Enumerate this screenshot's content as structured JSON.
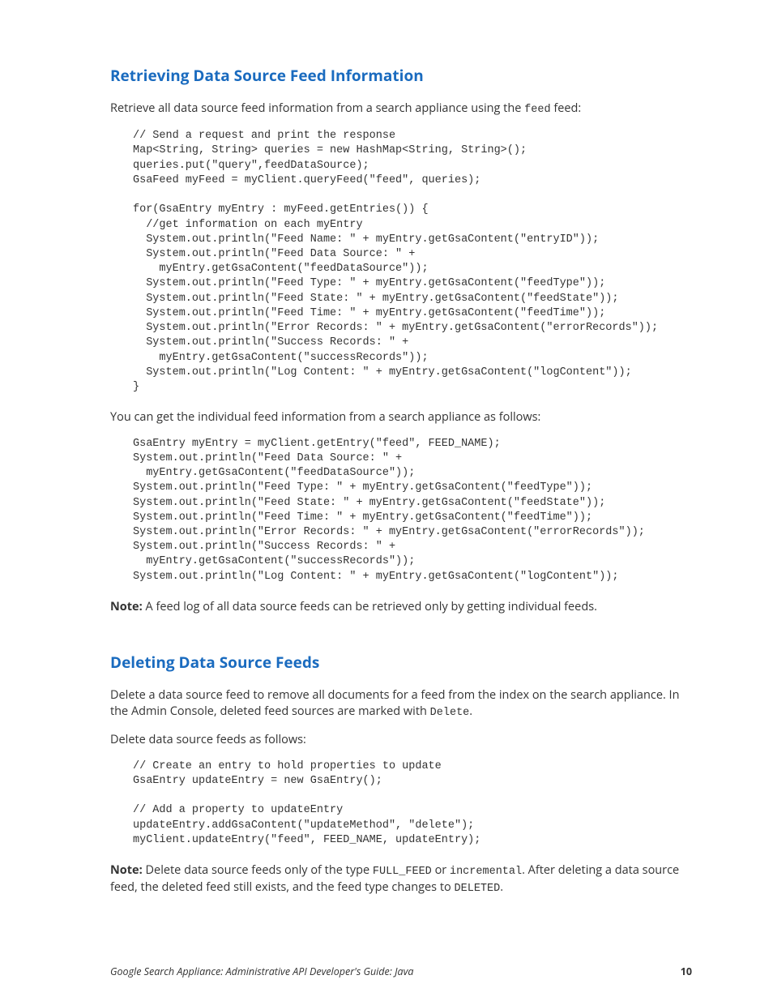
{
  "section1": {
    "heading": "Retrieving Data Source Feed Information",
    "intro_before": "Retrieve all data source feed information from a search appliance using the ",
    "intro_code": "feed",
    "intro_after": " feed:",
    "code1": "// Send a request and print the response\nMap<String, String> queries = new HashMap<String, String>();\nqueries.put(\"query\",feedDataSource);\nGsaFeed myFeed = myClient.queryFeed(\"feed\", queries);\n\nfor(GsaEntry myEntry : myFeed.getEntries()) {\n  //get information on each myEntry\n  System.out.println(\"Feed Name: \" + myEntry.getGsaContent(\"entryID\"));\n  System.out.println(\"Feed Data Source: \" +\n    myEntry.getGsaContent(\"feedDataSource\"));\n  System.out.println(\"Feed Type: \" + myEntry.getGsaContent(\"feedType\"));\n  System.out.println(\"Feed State: \" + myEntry.getGsaContent(\"feedState\"));\n  System.out.println(\"Feed Time: \" + myEntry.getGsaContent(\"feedTime\"));\n  System.out.println(\"Error Records: \" + myEntry.getGsaContent(\"errorRecords\"));\n  System.out.println(\"Success Records: \" +\n    myEntry.getGsaContent(\"successRecords\"));\n  System.out.println(\"Log Content: \" + myEntry.getGsaContent(\"logContent\"));\n}",
    "para2": "You can get the individual feed information from a search appliance as follows:",
    "code2": "GsaEntry myEntry = myClient.getEntry(\"feed\", FEED_NAME);\nSystem.out.println(\"Feed Data Source: \" +\n  myEntry.getGsaContent(\"feedDataSource\"));\nSystem.out.println(\"Feed Type: \" + myEntry.getGsaContent(\"feedType\"));\nSystem.out.println(\"Feed State: \" + myEntry.getGsaContent(\"feedState\"));\nSystem.out.println(\"Feed Time: \" + myEntry.getGsaContent(\"feedTime\"));\nSystem.out.println(\"Error Records: \" + myEntry.getGsaContent(\"errorRecords\"));\nSystem.out.println(\"Success Records: \" +\n  myEntry.getGsaContent(\"successRecords\"));\nSystem.out.println(\"Log Content: \" + myEntry.getGsaContent(\"logContent\"));",
    "note_label": "Note:",
    "note_text": "  A feed log of all data source feeds can be retrieved only by getting individual feeds."
  },
  "section2": {
    "heading": "Deleting Data Source Feeds",
    "para1_before": "Delete a data source feed to remove all documents for a feed from the index on the search appliance. In the Admin Console, deleted feed sources are marked with ",
    "para1_code": "Delete",
    "para1_after": ".",
    "para2": "Delete data source feeds as follows:",
    "code": "// Create an entry to hold properties to update\nGsaEntry updateEntry = new GsaEntry();\n\n// Add a property to updateEntry\nupdateEntry.addGsaContent(\"updateMethod\", \"delete\");\nmyClient.updateEntry(\"feed\", FEED_NAME, updateEntry);",
    "note_label": "Note:",
    "note_p1": "  Delete data source feeds only of the type ",
    "note_c1": "FULL_FEED",
    "note_p2": " or ",
    "note_c2": "incremental",
    "note_p3": ". After deleting a data source feed, the deleted feed still exists, and the feed type changes to ",
    "note_c3": "DELETED",
    "note_p4": "."
  },
  "footer": {
    "title": "Google Search Appliance: Administrative API Developer's Guide: Java",
    "page": "10"
  }
}
